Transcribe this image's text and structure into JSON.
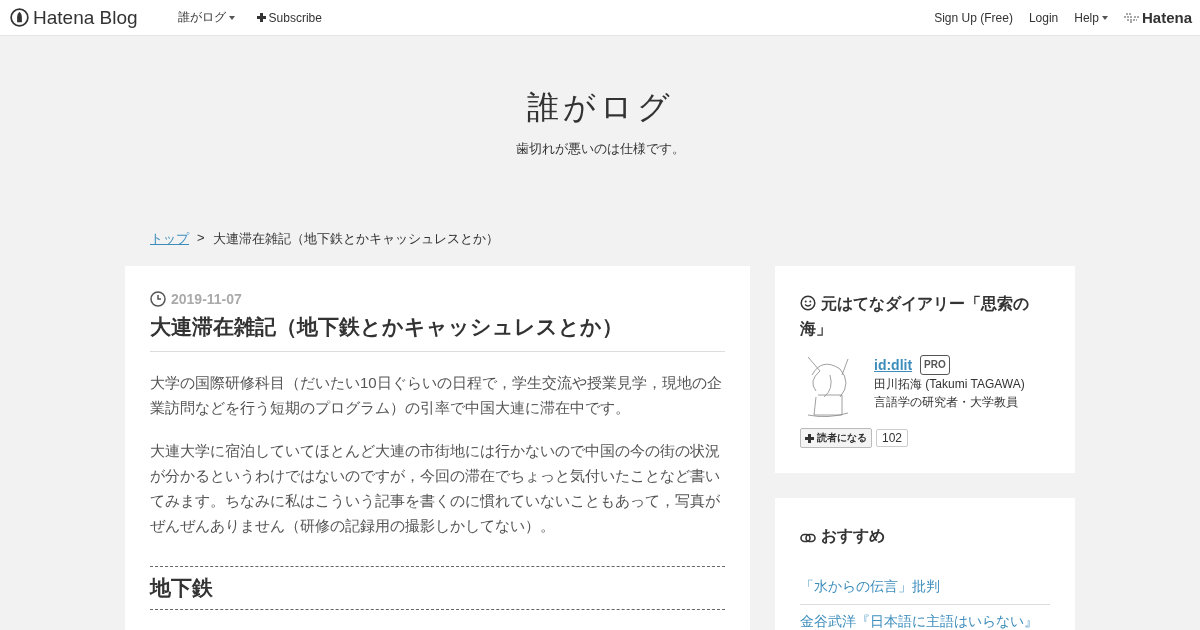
{
  "header": {
    "logo": "Hatena Blog",
    "blog_menu": "誰がログ",
    "subscribe": "Subscribe",
    "links": [
      "Sign Up (Free)",
      "Login"
    ],
    "help": "Help",
    "brand": "Hatena"
  },
  "blog": {
    "title": "誰がログ",
    "description": "歯切れが悪いのは仕様です。"
  },
  "breadcrumb": {
    "top": "トップ",
    "separator": ">",
    "current": "大連滞在雑記（地下鉄とかキャッシュレスとか）"
  },
  "article": {
    "date": "2019-11-07",
    "title": "大連滞在雑記（地下鉄とかキャッシュレスとか）",
    "paragraphs": [
      "大学の国際研修科目（だいたい10日ぐらいの日程で，学生交流や授業見学，現地の企業訪問などを行う短期のプログラム）の引率で中国大連に滞在中です。",
      "大連大学に宿泊していてほとんど大連の市街地には行かないので中国の今の街の状況が分かるというわけではないのですが，今回の滞在でちょっと気付いたことなど書いてみます。ちなみに私はこういう記事を書くのに慣れていないこともあって，写真がぜんぜんありません（研修の記録用の撮影しかしてない）。"
    ],
    "section_heading": "地下鉄"
  },
  "sidebar": {
    "profile": {
      "heading": "元はてなダイアリー「思索の海」",
      "user_id": "id:dlit",
      "badge": "PRO",
      "name": "田川拓海 (Takumi TAGAWA)",
      "bio": "言語学の研究者・大学教員",
      "subscribe_button": "読者になる",
      "subscriber_count": "102"
    },
    "recommended": {
      "heading": "おすすめ",
      "links": [
        "「水からの伝言」批判",
        "金谷武洋『日本語に主語はいらない』"
      ]
    }
  }
}
